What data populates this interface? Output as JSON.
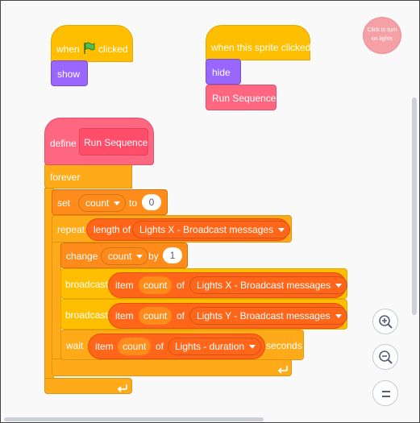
{
  "script1": {
    "when": "when",
    "clicked": "clicked",
    "show": "show"
  },
  "script2": {
    "hat": "when this sprite clicked",
    "hide": "hide",
    "run": "Run Sequence"
  },
  "sprite_label": "Click to turn on lights",
  "define": {
    "keyword": "define",
    "name": "Run Sequence"
  },
  "forever": "forever",
  "set": {
    "label": "set",
    "var": "count",
    "to": "to",
    "value": "0"
  },
  "repeat": {
    "label": "repeat",
    "length_of": "length of",
    "list": "Lights X - Broadcast messages"
  },
  "change": {
    "label": "change",
    "var": "count",
    "by": "by",
    "value": "1"
  },
  "broadcast1": {
    "label": "broadcast",
    "item": "item",
    "var": "count",
    "of": "of",
    "list": "Lights X - Broadcast messages"
  },
  "broadcast2": {
    "label": "broadcast",
    "item": "item",
    "var": "count",
    "of": "of",
    "list": "Lights Y - Broadcast messages"
  },
  "wait": {
    "label": "wait",
    "item": "item",
    "var": "count",
    "of": "of",
    "list": "Lights - duration",
    "seconds": "seconds"
  },
  "controls": {
    "zoom_in": "zoom-in-icon",
    "zoom_out": "zoom-out-icon",
    "reset": "zoom-reset-icon"
  },
  "colors": {
    "events": "#ffbf00",
    "control": "#ffab19",
    "looks": "#9966ff",
    "my_blocks": "#ff6680",
    "variables": "#ff8c1a",
    "lists": "#ff661a"
  }
}
